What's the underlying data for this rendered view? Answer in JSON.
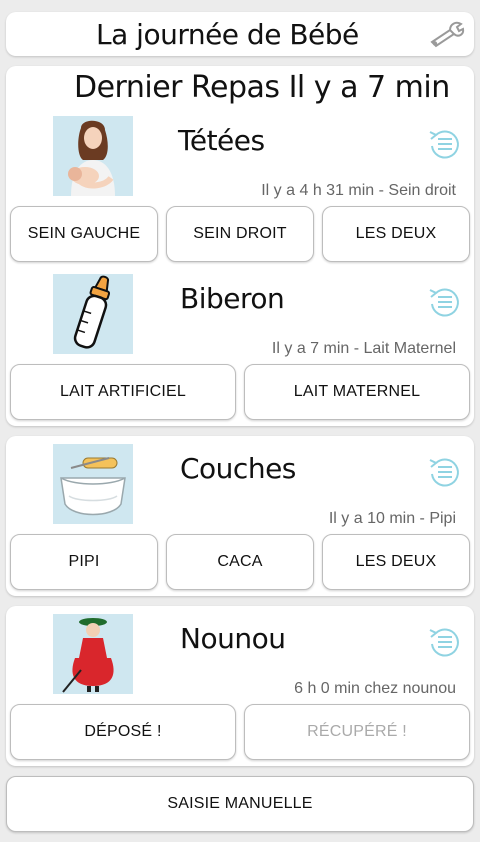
{
  "header": {
    "title": "La journée de Bébé",
    "settings_icon": "wrench-icon"
  },
  "summary": {
    "title": "Dernier Repas Il y a 7 min"
  },
  "tetees": {
    "title": "Tétées",
    "status": "Il y a 4 h 31 min  - Sein droit",
    "buttons": [
      "SEIN GAUCHE",
      "SEIN DROIT",
      "LES DEUX"
    ]
  },
  "biberon": {
    "title": "Biberon",
    "status": "Il y a 7 min  - Lait Maternel",
    "buttons": [
      "LAIT ARTIFICIEL",
      "LAIT MATERNEL"
    ]
  },
  "couches": {
    "title": "Couches",
    "status": "Il y a 10 min  - Pipi",
    "buttons": [
      "PIPI",
      "CACA",
      "LES DEUX"
    ]
  },
  "nounou": {
    "title": "Nounou",
    "status": "6 h 0 min chez nounou",
    "buttons": [
      "DÉPOSÉ !",
      "RÉCUPÉRÉ !"
    ]
  },
  "footer": {
    "manual_label": "SAISIE MANUELLE"
  },
  "colors": {
    "accent": "#8fd3e2",
    "thumb_bg": "#cfe7f0",
    "disabled_text": "#aaaaaa"
  }
}
